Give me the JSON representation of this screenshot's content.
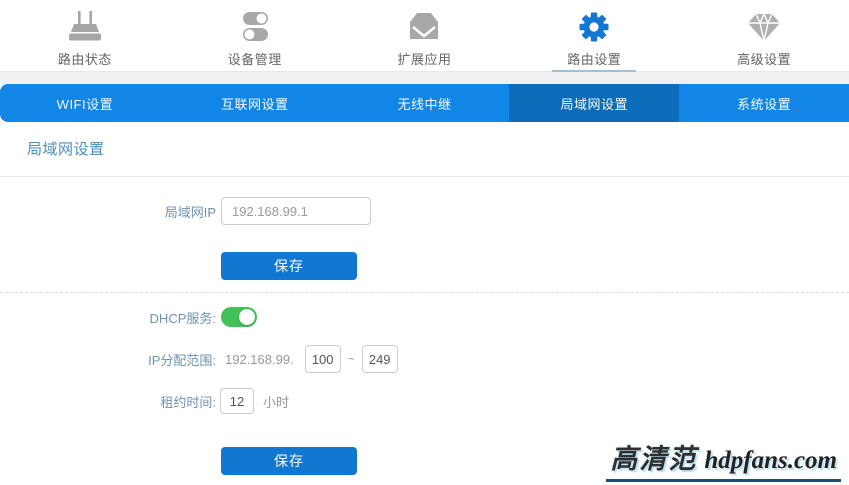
{
  "nav": {
    "items": [
      {
        "label": "路由状态",
        "icon": "router-icon",
        "active": false
      },
      {
        "label": "设备管理",
        "icon": "toggles-icon",
        "active": false
      },
      {
        "label": "扩展应用",
        "icon": "box-icon",
        "active": false
      },
      {
        "label": "路由设置",
        "icon": "gear-icon",
        "active": true
      },
      {
        "label": "高级设置",
        "icon": "diamond-icon",
        "active": false
      }
    ]
  },
  "subnav": {
    "items": [
      {
        "label": "WIFI设置",
        "active": false
      },
      {
        "label": "互联网设置",
        "active": false
      },
      {
        "label": "无线中继",
        "active": false
      },
      {
        "label": "局域网设置",
        "active": true
      },
      {
        "label": "系统设置",
        "active": false
      }
    ]
  },
  "page": {
    "title": "局域网设置"
  },
  "form": {
    "lan_ip": {
      "label": "局域网IP",
      "value": "192.168.99.1"
    },
    "save_label": "保存",
    "dhcp": {
      "label": "DHCP服务:",
      "enabled": true
    },
    "ip_range": {
      "label": "IP分配范围:",
      "prefix": "192.168.99.",
      "start": "100",
      "separator": "~",
      "end": "249"
    },
    "lease": {
      "label": "租约时间:",
      "value": "12",
      "unit": "小时"
    }
  },
  "watermark": {
    "cn": "高清范",
    "en": "hdpfans.com"
  },
  "colors": {
    "subnav_bg": "#1286e6",
    "subnav_active_bg": "#0c6cba",
    "button_bg": "#1177d1",
    "active_icon": "#1478d2",
    "toggle_on": "#42c158",
    "label_text": "#6d93b0",
    "title_text": "#4a8fc0"
  }
}
